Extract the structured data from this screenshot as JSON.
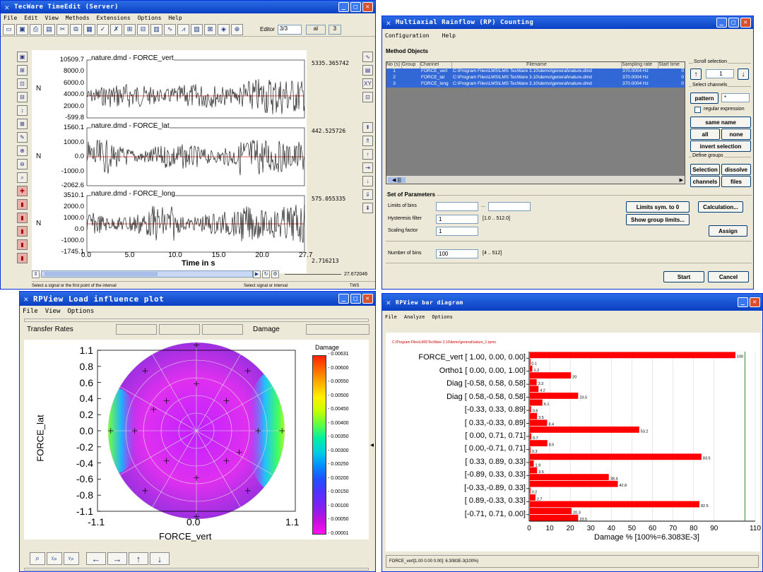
{
  "timeedit": {
    "title": "TecWare TimeEdit (Server)",
    "menu": [
      "File",
      "Edit",
      "View",
      "Methods",
      "Extensions",
      "Options",
      "Help"
    ],
    "editor_label": "Editor",
    "editor_value": "3/3",
    "editor_ext1": "al",
    "editor_ext2": "3",
    "channels": [
      {
        "name": "nature.dmd - FORCE_vert",
        "ticks": [
          "10509.7",
          "8000.0",
          "6000.0",
          "4000.0",
          "2000.0",
          "-599.8"
        ],
        "right": "5335.365742"
      },
      {
        "name": "nature.dmd - FORCE_lat",
        "ticks": [
          "1560.1",
          "1000.0",
          "0.0",
          "-1000.0",
          "-2062.6"
        ],
        "right": "442.525726"
      },
      {
        "name": "nature.dmd - FORCE_long",
        "ticks": [
          "3510.1",
          "2000.0",
          "1000.0",
          "0.0",
          "-1000.0",
          "-1745.1"
        ],
        "right": "575.055335"
      }
    ],
    "unit": "N",
    "x_ticks": [
      "0.0",
      "5.0",
      "10.0",
      "15.0",
      "20.0",
      "27.7"
    ],
    "x_label": "Time in s",
    "bottom_right_value": "2.716213",
    "scroll_value": "27.672046",
    "status_left": "Select a signal or the first point of the interval",
    "status_right": "Select signal or interval",
    "status_corner": "TWS"
  },
  "rainflow": {
    "title": "Multiaxial Rainflow (RP) Counting",
    "menu": [
      "Configuration",
      "Help"
    ],
    "method_objects": "Method Objects",
    "columns": [
      "No (s)",
      "Group",
      "Channel",
      "Filename",
      "Sampling rate",
      "Start time"
    ],
    "rows": [
      {
        "no": "1",
        "group": "",
        "channel": "FORCE_vert",
        "filename": "C:\\Program Files\\LMS\\LMS TecWare 3.10\\demo\\general\\nature.dmd",
        "rate": "370.0004 Hz",
        "start": "0"
      },
      {
        "no": "2",
        "group": "",
        "channel": "FORCE_lat",
        "filename": "C:\\Program Files\\LMS\\LMS TecWare 3.10\\demo\\general\\nature.dmd",
        "rate": "370.0004 Hz",
        "start": "0"
      },
      {
        "no": "3",
        "group": "",
        "channel": "FORCE_long",
        "filename": "C:\\Program Files\\LMS\\LMS TecWare 3.10\\demo\\general\\nature.dmd",
        "rate": "370.0004 Hz",
        "start": "0"
      }
    ],
    "scroll_selection": "Scroll selection",
    "scroll_value": "1",
    "select_channels": "Select channels",
    "pattern_btn": "pattern",
    "pattern_value": "*",
    "regex_label": "regular expression",
    "same_name_btn": "same name",
    "all_btn": "all",
    "none_btn": "none",
    "invert_btn": "invert selection",
    "define_groups": "Define groups",
    "selection_btn": "Selection",
    "dissolve_btn": "dissolve",
    "channels_btn": "channels",
    "files_btn": "files",
    "set_of_params": "Set of Parameters",
    "limits_label": "Limits of bins",
    "limits_sep": "...",
    "hysteresis_label": "Hysteresis filter",
    "hysteresis_value": "1",
    "hysteresis_range": "[1.0 .. 512.0]",
    "scaling_label": "Scaling factor",
    "scaling_value": "1",
    "limits_sym_btn": "Limits sym. to 0",
    "show_group_btn": "Show group limits...",
    "calc_btn": "Calculation...",
    "assign_btn": "Assign",
    "num_bins_label": "Number of bins",
    "num_bins_value": "100",
    "num_bins_range": "[4 .. 512]",
    "start_btn": "Start",
    "cancel_btn": "Cancel"
  },
  "influence": {
    "title": "RPView Load influence plot",
    "menu": [
      "File",
      "View",
      "Options"
    ],
    "transfer_label": "Transfer Rates",
    "damage_label": "Damage",
    "y_axis": "FORCE_lat",
    "x_axis": "FORCE_vert",
    "y_ticks": [
      "1.1",
      "0.8",
      "0.6",
      "0.4",
      "0.2",
      "0.0",
      "-0.2",
      "-0.4",
      "-0.6",
      "-0.8",
      "-1.1"
    ],
    "x_ticks": [
      "-1.1",
      "0.0",
      "1.1"
    ],
    "legend_title": "Damage",
    "legend_values": [
      "0.00631",
      "0.00600",
      "0.00550",
      "0.00500",
      "0.00450",
      "0.00400",
      "0.00350",
      "0.00300",
      "0.00250",
      "0.00200",
      "0.00150",
      "0.00100",
      "0.00050",
      "0.00001"
    ],
    "legend_colors": [
      "#ff2000",
      "#ff6a00",
      "#ffb000",
      "#fff000",
      "#c8ff00",
      "#60ff40",
      "#00f0a0",
      "#00d0e0",
      "#0090ff",
      "#2050ff",
      "#5030ff",
      "#8020f0",
      "#c010e0",
      "#ff10f0"
    ],
    "zoom_buttons": [
      "zoom-in-icon",
      "zoom-x-icon",
      "zoom-y-icon",
      "arrow-left-icon",
      "arrow-right-icon",
      "arrow-up-icon",
      "arrow-down-icon"
    ]
  },
  "bardiagram": {
    "title": "RPView bar diagram",
    "menu": [
      "File",
      "Analyze",
      "Options"
    ],
    "subtitle": "C:\\Program Files\\LMS\\TecWare 3.10\\demo\\general\\nature_1.rpms",
    "status": "FORCE_vert[1.00 0.00 0.00]: 6.3083E-3(100%)",
    "chart_data": {
      "type": "bar",
      "orientation": "horizontal",
      "xlabel": "Damage % [100%=6.3083E-3]",
      "xlim": [
        0,
        110
      ],
      "x_ticks": [
        0,
        10,
        20,
        30,
        40,
        50,
        60,
        70,
        80,
        90,
        110
      ],
      "categories": [
        "FORCE_vert [ 1.00, 0.00, 0.00]",
        "Ortho1 [ 0.00, 0.00, 1.00]",
        "Diag [-0.58, 0.58, 0.58]",
        "Diag [ 0.58,-0.58, 0.58]",
        "[-0.33, 0.33, 0.89]",
        "[ 0.33,-0.33, 0.89]",
        "[ 0.00, 0.71, 0.71]",
        "[ 0.00,-0.71, 0.71]",
        "[ 0.33, 0.89, 0.33]",
        "[-0.89, 0.33, 0.33]",
        "[-0.33,-0.89, 0.33]",
        "[ 0.89,-0.33, 0.33]",
        "[-0.71, 0.71, 0.00]"
      ],
      "bars": [
        {
          "value": 100,
          "label": "100"
        },
        {
          "value": 0.1,
          "label": "0.1"
        },
        {
          "value": 1.2,
          "label": "1.2"
        },
        {
          "value": 20,
          "label": "20"
        },
        {
          "value": 3.3,
          "label": "3.3"
        },
        {
          "value": 4.2,
          "label": "4.2"
        },
        {
          "value": 23.5,
          "label": "23.5"
        },
        {
          "value": 6.1,
          "label": "6.1"
        },
        {
          "value": 0.6,
          "label": "0.6"
        },
        {
          "value": 3.5,
          "label": "3.5"
        },
        {
          "value": 8.4,
          "label": "8.4"
        },
        {
          "value": 53.2,
          "label": "53.2"
        },
        {
          "value": 0.7,
          "label": "0.7"
        },
        {
          "value": 8.5,
          "label": "8.5"
        },
        {
          "value": 0.3,
          "label": "0.3"
        },
        {
          "value": 83.5,
          "label": "83.5"
        },
        {
          "value": 1.9,
          "label": "1.9"
        },
        {
          "value": 3.5,
          "label": "3.5"
        },
        {
          "value": 38.4,
          "label": "38.4"
        },
        {
          "value": 42.8,
          "label": "42.8"
        },
        {
          "value": 0.2,
          "label": "0.2"
        },
        {
          "value": 2.7,
          "label": "2.7"
        },
        {
          "value": 82.5,
          "label": "82.5"
        },
        {
          "value": 20.3,
          "label": "20.3"
        },
        {
          "value": 23.5,
          "label": "23.5"
        }
      ],
      "bar_color": "#ff0000",
      "reference_line": 105
    }
  }
}
